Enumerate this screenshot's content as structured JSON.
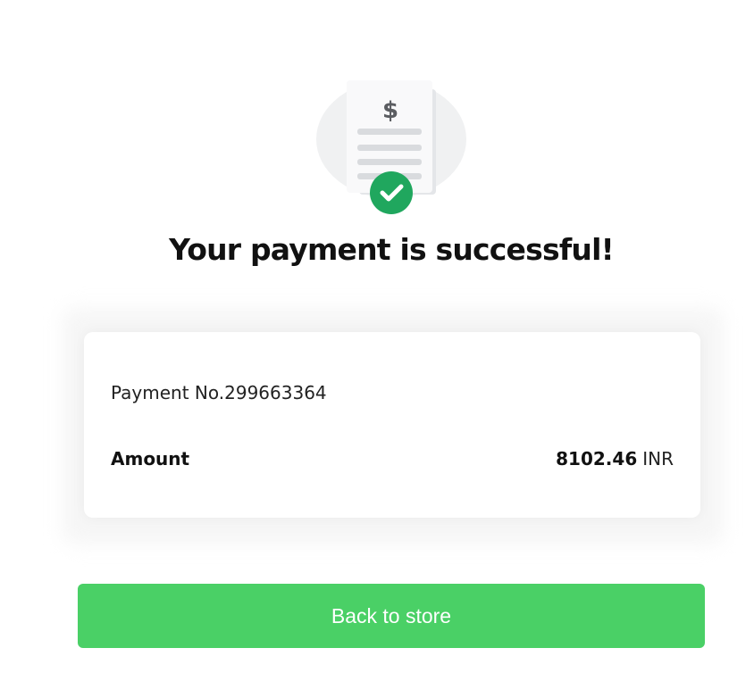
{
  "illustration": {
    "icon": "receipt-success-icon",
    "currency_symbol": "$",
    "check_icon": "check-icon",
    "accent_color": "#20a75e"
  },
  "title": "Your payment is successful!",
  "details": {
    "payment_label": "Payment No.",
    "payment_number": "299663364",
    "amount_label": "Amount",
    "amount_value": "8102.46",
    "currency": "INR"
  },
  "button": {
    "label": "Back to store",
    "color": "#4ad066"
  }
}
